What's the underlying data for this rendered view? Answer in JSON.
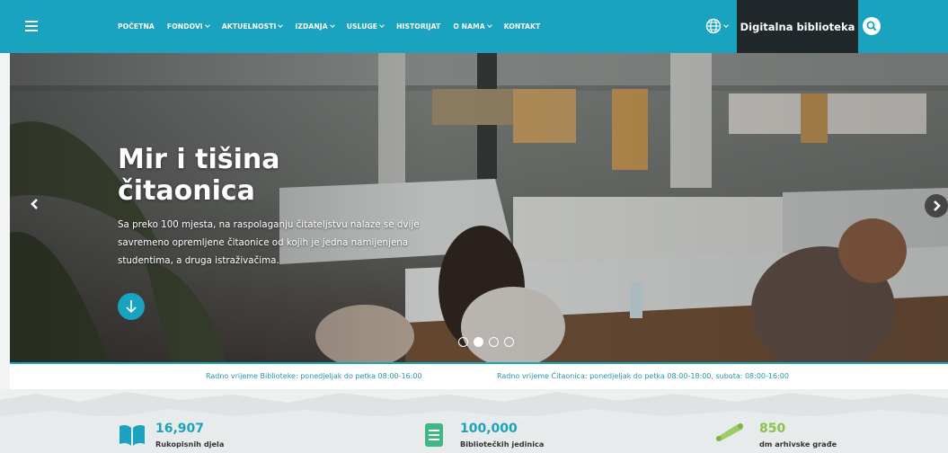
{
  "nav": {
    "menu": [
      {
        "label": "POČETNA",
        "dropdown": false
      },
      {
        "label": "FONDOVI",
        "dropdown": true
      },
      {
        "label": "AKTUELNOSTI",
        "dropdown": true
      },
      {
        "label": "IZDANJA",
        "dropdown": true
      },
      {
        "label": "USLUGE",
        "dropdown": true
      },
      {
        "label": "HISTORIJAT",
        "dropdown": false
      },
      {
        "label": "O NAMA",
        "dropdown": true
      },
      {
        "label": "KONTAKT",
        "dropdown": false
      }
    ],
    "digital_library_label": "Digitalna biblioteka",
    "icons": [
      "hamburger-icon",
      "globe-icon",
      "search-icon"
    ]
  },
  "colors": {
    "accent": "#1aa3bf",
    "dark": "#20282b",
    "hours_text": "#2496ab"
  },
  "hero": {
    "title_line1": "Mir i tišina",
    "title_line2": "čitaonica",
    "text": "Sa preko 100 mjesta, na raspolaganju čitateljstvu nalaze se dvije savremeno opremljene čitaonice od kojih je jedna namijenjena studentima, a druga istraživačima.",
    "slides_total": 4,
    "active_slide": 2
  },
  "hours": {
    "library": "Radno vrijeme Biblioteke: ponedjeljak do petka 08:00-16:00",
    "reading_room": "Radno vrijeme Čitaonica: ponedjeljak do petka 08:00-18:00, subota: 08:00-16:00"
  },
  "stats": [
    {
      "number": "16,907",
      "label": "Rukopisnih djela",
      "icon": "book-icon"
    },
    {
      "number": "100,000",
      "label": "Bibliotečkih jedinica",
      "icon": "document-icon"
    },
    {
      "number": "850",
      "label": "dm arhivske građe",
      "icon": "scroll-icon"
    }
  ]
}
